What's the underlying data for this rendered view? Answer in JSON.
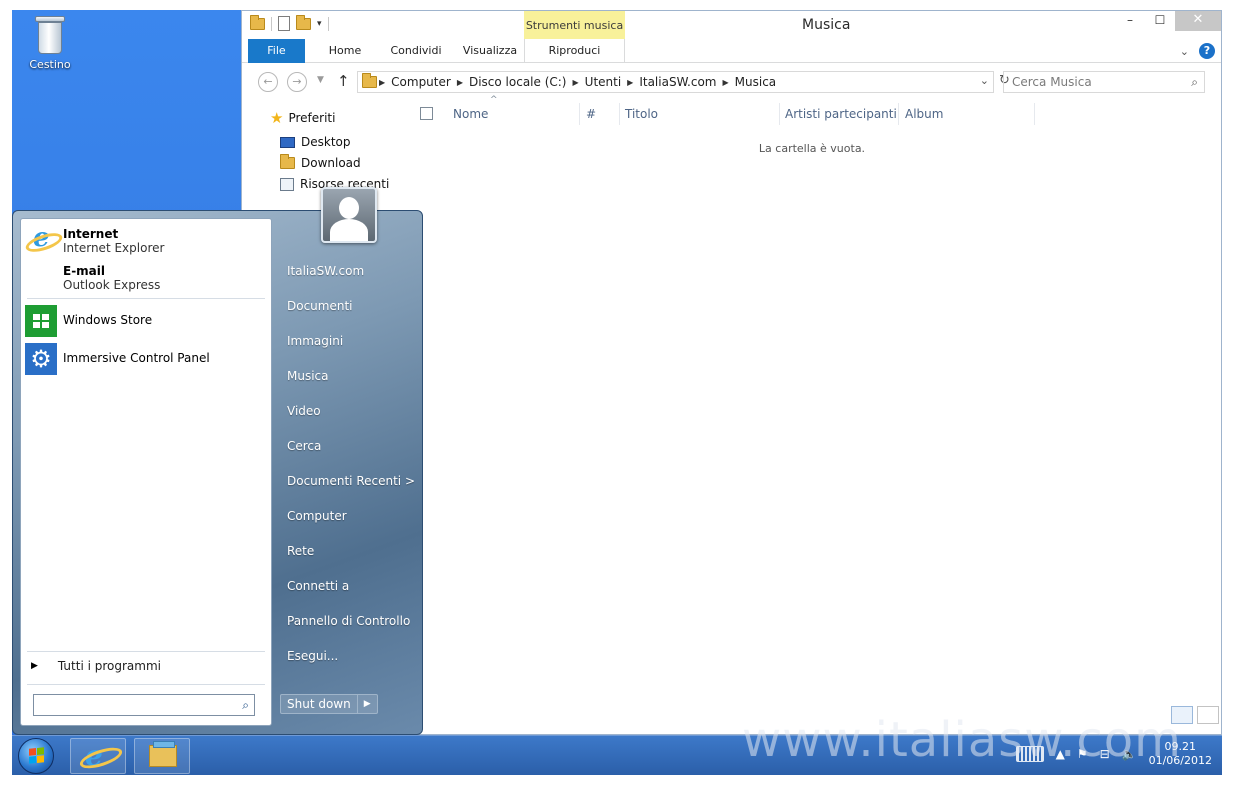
{
  "desktop": {
    "recycle_bin_label": "Cestino"
  },
  "explorer": {
    "title": "Musica",
    "contextual_tab": "Strumenti musica",
    "tabs": [
      "File",
      "Home",
      "Condividi",
      "Visualizza",
      "Riproduci"
    ],
    "breadcrumb": [
      "Computer",
      "Disco locale (C:)",
      "Utenti",
      "ItaliaSW.com",
      "Musica"
    ],
    "search_placeholder": "Cerca Musica",
    "nav": {
      "favorites": "Preferiti",
      "items": [
        "Desktop",
        "Download",
        "Risorse recenti"
      ]
    },
    "columns": [
      "Nome",
      "#",
      "Titolo",
      "Artisti partecipanti",
      "Album"
    ],
    "empty_message": "La cartella è vuota."
  },
  "start_menu": {
    "pinned": [
      {
        "title": "Internet",
        "subtitle": "Internet Explorer"
      },
      {
        "title": "E-mail",
        "subtitle": "Outlook Express"
      }
    ],
    "programs": [
      "Windows Store",
      "Immersive Control Panel"
    ],
    "all_programs": "Tutti i programmi",
    "right_items": [
      "ItaliaSW.com",
      "Documenti",
      "Immagini",
      "Musica",
      "Video",
      "Cerca",
      "Documenti Recenti >",
      "Computer",
      "Rete",
      "Connetti a",
      "Pannello di Controllo",
      "Esegui..."
    ],
    "shutdown_label": "Shut down"
  },
  "taskbar": {
    "time": "09.21",
    "date": "01/06/2012"
  },
  "watermark": "www.italiasw.com",
  "icons": {
    "recycle_bin": "recycle-bin-icon",
    "favorites": "star-icon",
    "search": "magnifier-icon",
    "store": "windows-store-icon",
    "control_panel": "gear-icon"
  },
  "colors": {
    "desktop": "#2f6fd6",
    "file_tab": "#1979ca",
    "contextual_tab": "#f8f19a",
    "store_tile": "#1e9d33",
    "control_panel_tile": "#2a6fc7"
  }
}
